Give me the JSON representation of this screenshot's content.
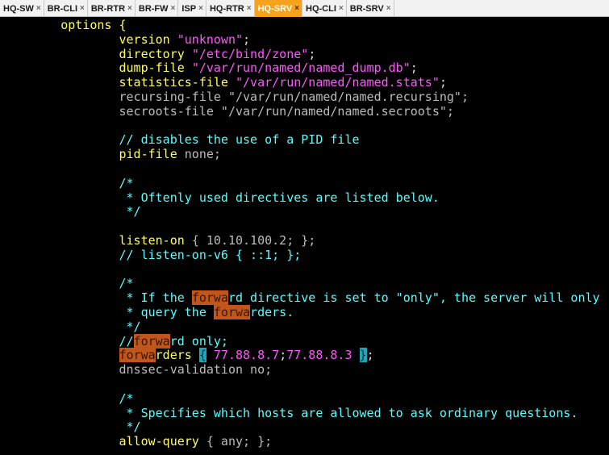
{
  "tabs": [
    {
      "label": "HQ-SW",
      "active": false
    },
    {
      "label": "BR-CLI",
      "active": false
    },
    {
      "label": "BR-RTR",
      "active": false
    },
    {
      "label": "BR-FW",
      "active": false
    },
    {
      "label": "ISP",
      "active": false
    },
    {
      "label": "HQ-RTR",
      "active": false
    },
    {
      "label": "HQ-SRV",
      "active": true
    },
    {
      "label": "HQ-CLI",
      "active": false
    },
    {
      "label": "BR-SRV",
      "active": false
    }
  ],
  "tab_close_glyph": "×",
  "colors": {
    "keyword": "#ffff55",
    "string": "#ff55ff",
    "comment": "#55ffff",
    "search_highlight": "#c0561c",
    "cursor": "#1fa6b8",
    "active_tab": "#f7a21b"
  },
  "lines": [
    [
      {
        "t": "        options {",
        "c": "kw"
      }
    ],
    [
      {
        "t": "                version ",
        "c": "kw"
      },
      {
        "t": "\"unknown\"",
        "c": "str"
      },
      {
        "t": ";",
        "c": "wt"
      }
    ],
    [
      {
        "t": "                directory ",
        "c": "kw"
      },
      {
        "t": "\"/etc/bind/zone\"",
        "c": "str"
      },
      {
        "t": ";",
        "c": "wt"
      }
    ],
    [
      {
        "t": "                dump-file ",
        "c": "kw"
      },
      {
        "t": "\"/var/run/named/named_dump.db\"",
        "c": "str"
      },
      {
        "t": ";",
        "c": "wt"
      }
    ],
    [
      {
        "t": "                statistics-file ",
        "c": "kw"
      },
      {
        "t": "\"/var/run/named/named.stats\"",
        "c": "str"
      },
      {
        "t": ";",
        "c": "wt"
      }
    ],
    [
      {
        "t": "                recursing-file \"/var/run/named/named.recursing\";",
        "c": "grey"
      }
    ],
    [
      {
        "t": "                secroots-file \"/var/run/named/named.secroots\";",
        "c": "grey"
      }
    ],
    [],
    [
      {
        "t": "                // disables the use of a PID file",
        "c": "cm"
      }
    ],
    [
      {
        "t": "                pid-file ",
        "c": "kw"
      },
      {
        "t": "none;",
        "c": "grey"
      }
    ],
    [],
    [
      {
        "t": "                /*",
        "c": "cm"
      }
    ],
    [
      {
        "t": "                 * Oftenly used directives are listed below.",
        "c": "cm"
      }
    ],
    [
      {
        "t": "                 */",
        "c": "cm"
      }
    ],
    [],
    [
      {
        "t": "                listen-on ",
        "c": "kw"
      },
      {
        "t": "{ 10.10.100.2; };",
        "c": "grey"
      }
    ],
    [
      {
        "t": "                // listen-on-v6 { ::1; };",
        "c": "cm"
      }
    ],
    [],
    [
      {
        "t": "                /*",
        "c": "cm"
      }
    ],
    [
      {
        "t": "                 * If the ",
        "c": "cm"
      },
      {
        "t": "forwa",
        "c": "hl"
      },
      {
        "t": "rd directive is set to \"only\", the server will only",
        "c": "cm"
      }
    ],
    [
      {
        "t": "                 * query the ",
        "c": "cm"
      },
      {
        "t": "forwa",
        "c": "hl"
      },
      {
        "t": "rders.",
        "c": "cm"
      }
    ],
    [
      {
        "t": "                 */",
        "c": "cm"
      }
    ],
    [
      {
        "t": "                //",
        "c": "cm"
      },
      {
        "t": "forwa",
        "c": "hl"
      },
      {
        "t": "rd only;",
        "c": "cm"
      }
    ],
    [
      {
        "t": "forwa",
        "c": "hl",
        "indent": 16
      },
      {
        "t": "rders ",
        "c": "kw"
      },
      {
        "t": "{",
        "c": "cur"
      },
      {
        "t": " 77.88.8.7",
        "c": "str"
      },
      {
        "t": ";",
        "c": "wt"
      },
      {
        "t": "77.88.8.3 ",
        "c": "str"
      },
      {
        "t": "}",
        "c": "cur"
      },
      {
        "t": ";",
        "c": "wt"
      }
    ],
    [
      {
        "t": "                dnssec-validation no;",
        "c": "grey"
      }
    ],
    [],
    [
      {
        "t": "                /*",
        "c": "cm"
      }
    ],
    [
      {
        "t": "                 * Specifies which hosts are allowed to ask ordinary questions.",
        "c": "cm"
      }
    ],
    [
      {
        "t": "                 */",
        "c": "cm"
      }
    ],
    [
      {
        "t": "                allow-query ",
        "c": "kw"
      },
      {
        "t": "{ any; };",
        "c": "grey"
      }
    ]
  ]
}
